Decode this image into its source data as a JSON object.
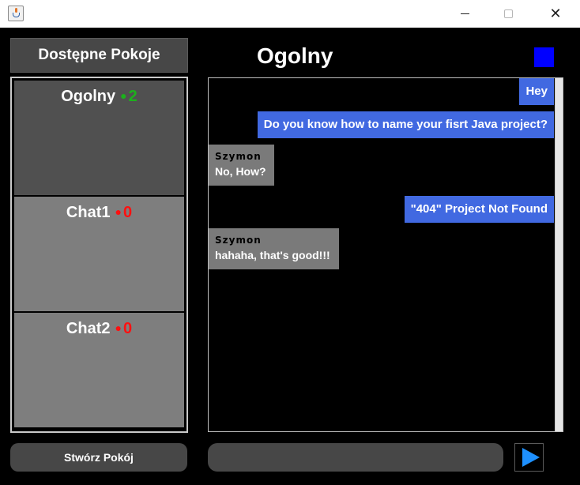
{
  "window": {
    "minimize_icon": "minimize-icon",
    "maximize_icon": "maximize-icon",
    "close_symbol": "✕"
  },
  "sidebar": {
    "header": "Dostępne Pokoje",
    "rooms": [
      {
        "name": "Ogolny",
        "dot": "●",
        "count": "2",
        "status_color": "#1cb01c",
        "active": true
      },
      {
        "name": "Chat1",
        "dot": "●",
        "count": "0",
        "status_color": "#ff1010",
        "active": false
      },
      {
        "name": "Chat2",
        "dot": "●",
        "count": "0",
        "status_color": "#ff1010",
        "active": false
      }
    ],
    "create_button": "Stwórz Pokój"
  },
  "chat": {
    "title": "Ogolny",
    "status_color": "#0000ff",
    "messages": [
      {
        "type": "sent",
        "text": "Hey"
      },
      {
        "type": "sent",
        "text": "Do you know how to name your fisrt Java project?"
      },
      {
        "type": "received",
        "sender": "Szymon",
        "text": "No, How?"
      },
      {
        "type": "sent",
        "text": "\"404\" Project Not Found"
      },
      {
        "type": "received",
        "sender": "Szymon",
        "text": "hahaha, that's good!!!"
      }
    ],
    "input_value": "",
    "send_icon": "play-arrow-icon"
  },
  "colors": {
    "sent_bubble": "#4169e1",
    "received_bubble": "#7a7a7a",
    "panel": "#474747",
    "send_arrow": "#1e90ff"
  }
}
